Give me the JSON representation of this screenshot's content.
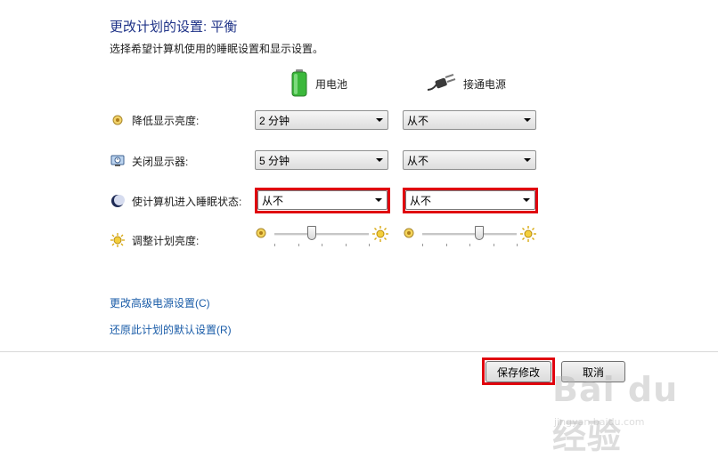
{
  "header": {
    "title": "更改计划的设置: 平衡",
    "subtitle": "选择希望计算机使用的睡眠设置和显示设置。"
  },
  "columns": {
    "battery": {
      "label": "用电池",
      "icon": "battery-icon"
    },
    "plugged": {
      "label": "接通电源",
      "icon": "power-plug-icon"
    }
  },
  "rows": {
    "dim": {
      "label": "降低显示亮度:",
      "icon": "dim-display-icon",
      "battery_value": "2 分钟",
      "plugged_value": "从不"
    },
    "display_off": {
      "label": "关闭显示器:",
      "icon": "monitor-icon",
      "battery_value": "5 分钟",
      "plugged_value": "从不"
    },
    "sleep": {
      "label": "使计算机进入睡眠状态:",
      "icon": "moon-icon",
      "battery_value": "从不",
      "plugged_value": "从不"
    },
    "brightness": {
      "label": "调整计划亮度:",
      "icon": "sun-icon",
      "battery_level": 0.4,
      "plugged_level": 0.6
    }
  },
  "links": {
    "advanced": "更改高级电源设置(C)",
    "restore": "还原此计划的默认设置(R)"
  },
  "buttons": {
    "save": "保存修改",
    "cancel": "取消"
  },
  "watermark": {
    "logo": "Bai du 经验",
    "url": "jingyan.baidu.com"
  },
  "colors": {
    "title": "#1e3287",
    "link": "#1a5ca8",
    "highlight": "#e0000e"
  }
}
